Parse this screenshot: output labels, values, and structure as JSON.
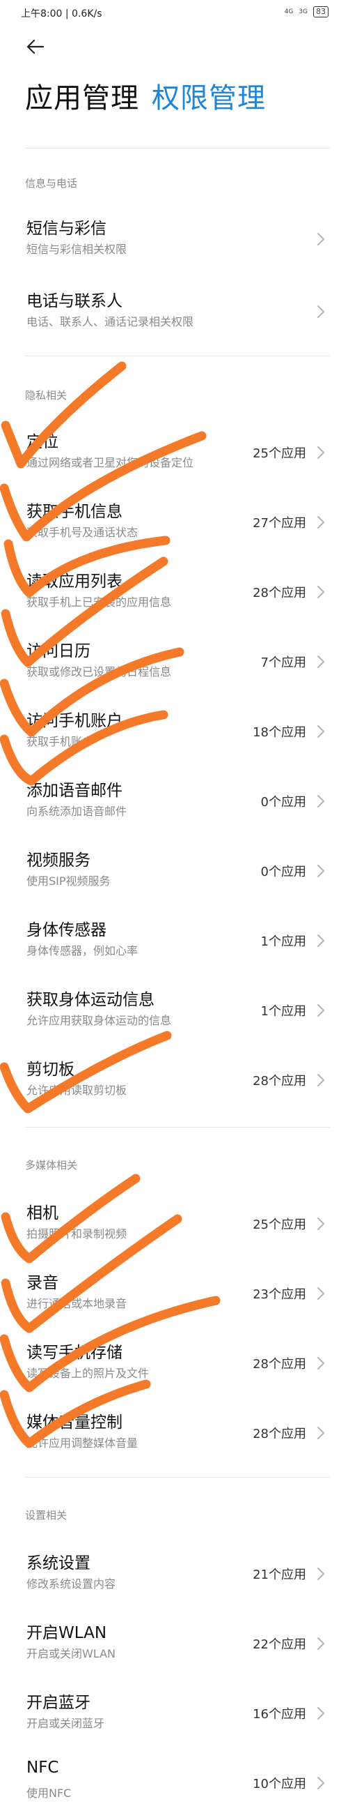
{
  "status": {
    "time": "上午8:00 | 0.6K/s",
    "signal1": "4G",
    "signal2": "3G",
    "battery": "83"
  },
  "header": {
    "title": "应用管理",
    "subtitle": "权限管理"
  },
  "sections": [
    {
      "header": "信息与电话",
      "items": [
        {
          "title": "短信与彩信",
          "subtitle": "短信与彩信相关权限",
          "count": ""
        },
        {
          "title": "电话与联系人",
          "subtitle": "电话、联系人、通话记录相关权限",
          "count": ""
        }
      ]
    },
    {
      "header": "隐私相关",
      "items": [
        {
          "title": "定位",
          "subtitle": "通过网络或者卫星对您的设备定位",
          "count": "25个应用"
        },
        {
          "title": "获取手机信息",
          "subtitle": "获取手机号及通话状态",
          "count": "27个应用"
        },
        {
          "title": "读取应用列表",
          "subtitle": "获取手机上已安装的应用信息",
          "count": "28个应用"
        },
        {
          "title": "访问日历",
          "subtitle": "获取或修改已设置的日程信息",
          "count": "7个应用"
        },
        {
          "title": "访问手机账户",
          "subtitle": "获取手机账户",
          "count": "18个应用"
        },
        {
          "title": "添加语音邮件",
          "subtitle": "向系统添加语音邮件",
          "count": "0个应用"
        },
        {
          "title": "视频服务",
          "subtitle": "使用SIP视频服务",
          "count": "0个应用"
        },
        {
          "title": "身体传感器",
          "subtitle": "身体传感器，例如心率",
          "count": "1个应用"
        },
        {
          "title": "获取身体运动信息",
          "subtitle": "允许应用获取身体运动的信息",
          "count": "1个应用"
        },
        {
          "title": "剪切板",
          "subtitle": "允许应用读取剪切板",
          "count": "28个应用"
        }
      ]
    },
    {
      "header": "多媒体相关",
      "items": [
        {
          "title": "相机",
          "subtitle": "拍摄照片和录制视频",
          "count": "25个应用"
        },
        {
          "title": "录音",
          "subtitle": "进行通话或本地录音",
          "count": "23个应用"
        },
        {
          "title": "读写手机存储",
          "subtitle": "读写设备上的照片及文件",
          "count": "28个应用"
        },
        {
          "title": "媒体音量控制",
          "subtitle": "允许应用调整媒体音量",
          "count": "28个应用"
        }
      ]
    },
    {
      "header": "设置相关",
      "items": [
        {
          "title": "系统设置",
          "subtitle": "修改系统设置内容",
          "count": "21个应用"
        },
        {
          "title": "开启WLAN",
          "subtitle": "开启或关闭WLAN",
          "count": "22个应用"
        },
        {
          "title": "开启蓝牙",
          "subtitle": "开启或关闭蓝牙",
          "count": "16个应用"
        },
        {
          "title": "NFC",
          "subtitle": "使用NFC",
          "count": "10个应用"
        }
      ]
    }
  ],
  "colors": {
    "accent": "#1e86d8",
    "annotation": "#f47a2a"
  }
}
